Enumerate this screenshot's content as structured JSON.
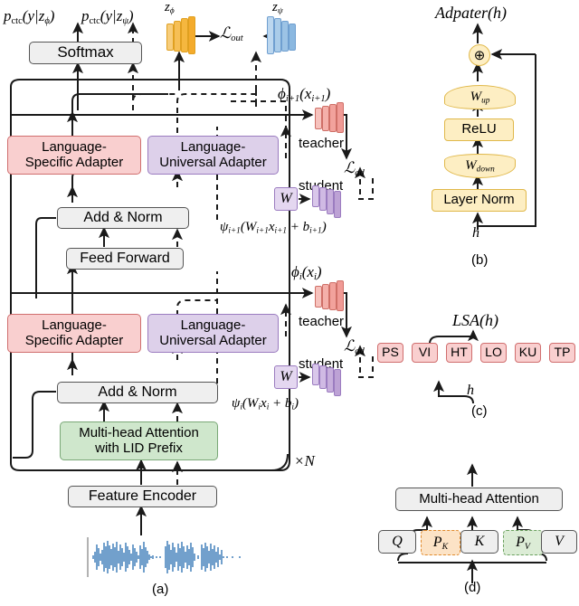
{
  "figure": {
    "title": "Multilingual ASR architecture with language adapters",
    "panels": [
      {
        "id": "a",
        "caption": "(a)"
      },
      {
        "id": "b",
        "caption": "(b)"
      },
      {
        "id": "c",
        "caption": "(c)"
      },
      {
        "id": "d",
        "caption": "(d)"
      }
    ]
  },
  "panel_a": {
    "outputs": {
      "p_phi": "p_ctc(y|z_ϕ)",
      "p_psi": "p_ctc(y|z_ψ)",
      "softmax": "Softmax"
    },
    "latent": {
      "z_phi": "z_ϕ",
      "z_psi": "z_ψ",
      "loss_out": "L_out"
    },
    "blocks": {
      "lang_specific_adapter": "Language-\nSpecific Adapter",
      "lang_specific_line1": "Language-",
      "lang_specific_line2": "Specific Adapter",
      "lang_universal_line1": "Language-",
      "lang_universal_line2": "Universal Adapter",
      "add_norm": "Add & Norm",
      "feed_forward": "Feed Forward",
      "mha_lid_line1": "Multi-head Attention",
      "mha_lid_line2": "with LID Prefix",
      "feature_encoder": "Feature Encoder"
    },
    "repeat_label": "×N",
    "distill": {
      "teacher": "teacher",
      "student": "student",
      "loss_ad": "L_ad",
      "w_box": "W",
      "phi_upper": "ϕ_i+1(x_i+1)",
      "psi_upper": "ψ_i+1(W_i+1 x_i+1 + b_i+1)",
      "phi_lower": "ϕ_i(x_i)",
      "psi_lower": "ψ_i(W_i x_i + b_i)"
    },
    "caption": "(a)"
  },
  "panel_b": {
    "title": "Adpater(h)",
    "stages": [
      "W_up",
      "ReLU",
      "W_down",
      "Layer Norm"
    ],
    "input": "h",
    "sum_node": "⊕",
    "caption": "(b)"
  },
  "panel_c": {
    "title": "LSA(h)",
    "languages": [
      "PS",
      "VI",
      "HT",
      "LO",
      "KU",
      "TP"
    ],
    "selected_language": "VI",
    "input": "h",
    "caption": "(c)"
  },
  "panel_d": {
    "attention": "Multi-head Attention",
    "inputs": [
      "Q",
      "P_K",
      "K",
      "P_V",
      "V"
    ],
    "prefix_k": "P_K",
    "prefix_v": "P_V",
    "caption": "(d)"
  },
  "colors": {
    "pink": "#f9cfcf",
    "pink_border": "#d06e6e",
    "purple": "#ddd0ea",
    "purple_border": "#9b7cc0",
    "green": "#cfe7cc",
    "green_border": "#7aa877",
    "yellow": "#fdeec3",
    "yellow_border": "#e0b84a",
    "grey": "#efefef",
    "grey_border": "#555555",
    "orange_ribbon": "#f4ab2c",
    "blue_ribbon": "#9cc3e5",
    "red_ribbon": "#f09a95",
    "violet_ribbon": "#c7aedc",
    "waveform": "#2f72b4"
  }
}
